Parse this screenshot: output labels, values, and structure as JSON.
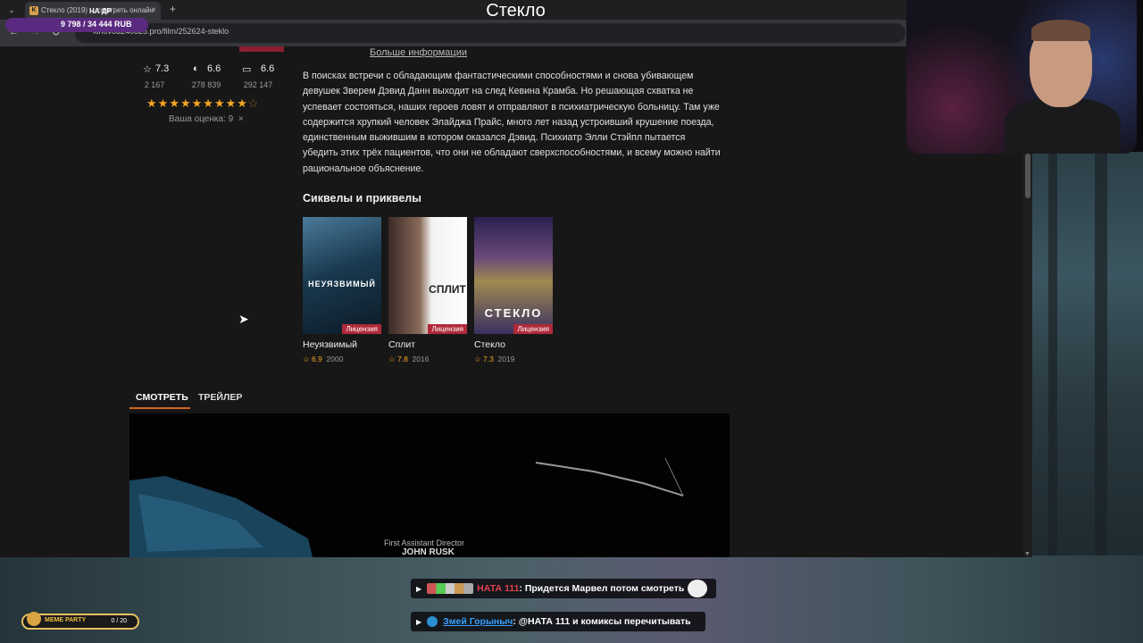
{
  "browser": {
    "tab_title": "Стекло (2019) ... смотреть онлайн",
    "tab_close": "×",
    "new_tab": "+",
    "url": "kinovod240825.pro/film/252624-steklo"
  },
  "stream": {
    "title": "Стекло",
    "overlay_mid": "НА ДР",
    "donation": "9 798 / 34 444 RUB",
    "meme_label": "MEME PARTY",
    "meme_count": "0 / 20"
  },
  "page": {
    "more_info": "Больше информации",
    "ratings": [
      {
        "icon": "star-outline-icon",
        "value": "7.3",
        "count": "2 167"
      },
      {
        "icon": "kinopoisk-icon",
        "value": "6.6",
        "count": "278 839"
      },
      {
        "icon": "imdb-icon",
        "value": "6.6",
        "count": "292 147"
      }
    ],
    "user_rating": 9,
    "your_rating_label": "Ваша оценка: 9",
    "remove_rating": "×",
    "description": "В поисках встречи с обладающим фантастическими способностями и снова убивающем девушек Зверем Дэвид Данн выходит на след Кевина Крамба. Но решающая схватка не успевает состояться, наших героев ловят и отправляют в психиатрическую больницу. Там уже содержится хрупкий человек Элайджа Прайс, много лет назад устроивший крушение поезда, единственным выжившим в котором оказался Дэвид. Психиатр Элли Стэйпл пытается убедить этих трёх пациентов, что они не обладают сверхспособностями, и всему можно найти рациональное объяснение.",
    "sequels_heading": "Сиквелы и приквелы",
    "movies": [
      {
        "title": "Неуязвимый",
        "poster_text": "НЕУЯЗВИМЫЙ",
        "badge": "Лицензия",
        "rating": "6.9",
        "year": "2000"
      },
      {
        "title": "Сплит",
        "poster_text": "СПЛИТ",
        "badge": "Лицензия",
        "rating": "7.8",
        "year": "2016"
      },
      {
        "title": "Стекло",
        "poster_text": "СТЕКЛО",
        "badge": "Лицензия",
        "rating": "7.3",
        "year": "2019"
      }
    ],
    "tabs": {
      "watch": "СМОТРЕТЬ",
      "trailer": "ТРЕЙЛЕР"
    },
    "player": {
      "credit_role": "First Assistant Director",
      "credit_name": "JOHN RUSK"
    }
  },
  "chat": [
    {
      "user": "НАТА 111",
      "text": "Придется Марвел потом смотреть"
    },
    {
      "user": "Змей Горыныч",
      "text": "@НАТА 111 и комиксы перечитывать"
    }
  ]
}
